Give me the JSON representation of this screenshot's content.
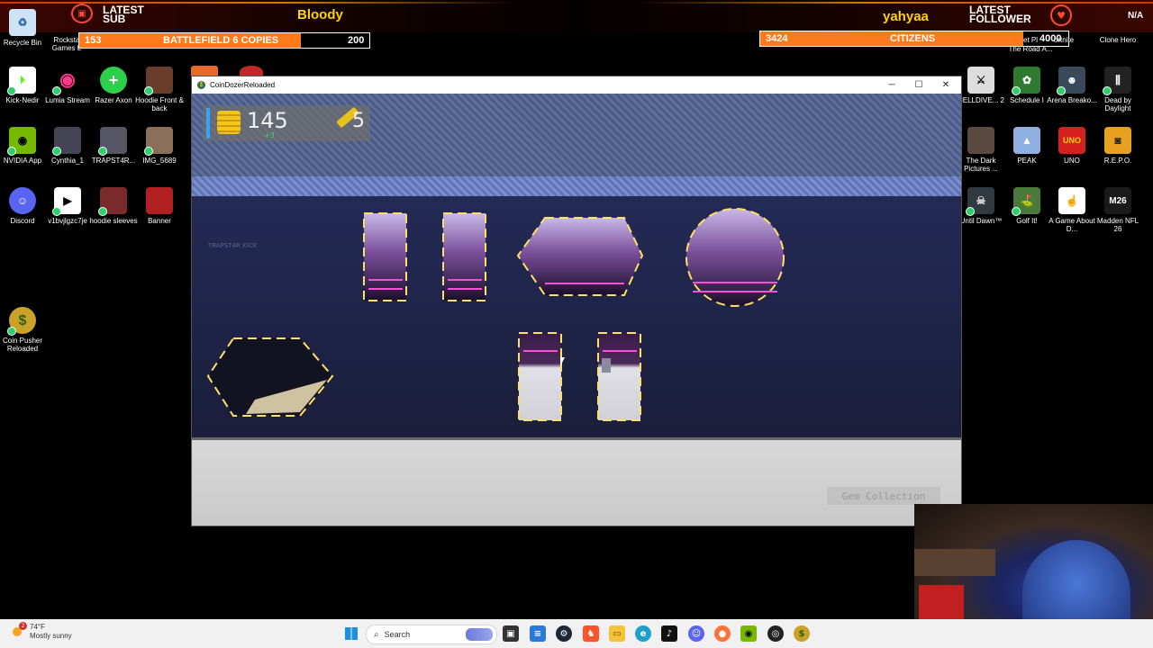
{
  "overlay": {
    "latest_sub_label": "LATEST\nSUB",
    "latest_sub_name": "Bloody",
    "latest_follower_label": "LATEST\nFOLLOWER",
    "latest_follower_name": "yahyaa",
    "corner_text": "N/A",
    "goal_left": {
      "current": "153",
      "title": "BATTLEFIELD 6 COPIES",
      "target": "200",
      "progress": 0.765
    },
    "goal_right": {
      "current": "3424",
      "title": "CITIZENS",
      "target": "4000",
      "progress": 0.856
    },
    "colors": {
      "accent": "#ff7a1a",
      "latest_name": "#ffd400",
      "heart": "#ff4a3a"
    }
  },
  "desktop_left": [
    {
      "label": "Recycle Bin",
      "icon": "recycle-bin-icon"
    },
    {
      "label": "Rocksta Games L",
      "icon": "rockstar-icon"
    },
    {
      "label": "Kick-Nedir",
      "icon": "kick-icon"
    },
    {
      "label": "Lumia Stream",
      "icon": "lumia-icon"
    },
    {
      "label": "Razer Axon",
      "icon": "razer-icon"
    },
    {
      "label": "Hoodie Front & back",
      "icon": "image-icon"
    },
    {
      "label": "NVIDIA App",
      "icon": "nvidia-icon"
    },
    {
      "label": "Cynthia_1",
      "icon": "image-icon"
    },
    {
      "label": "TRAPST4R...",
      "icon": "image-icon"
    },
    {
      "label": "IMG_5689",
      "icon": "image-icon"
    },
    {
      "label": "Discord",
      "icon": "discord-icon"
    },
    {
      "label": "v1bvjlgzc7je",
      "icon": "video-icon"
    },
    {
      "label": "hoodie sleeves",
      "icon": "image-icon"
    },
    {
      "label": "Banner",
      "icon": "image-icon"
    },
    {
      "label": "Coin Pusher Reloaded",
      "icon": "coin-icon"
    }
  ],
  "desktop_right": [
    {
      "label": "et Pl",
      "icon": "app-icon"
    },
    {
      "label": "ortnite",
      "icon": "fortnite-icon"
    },
    {
      "label": "Clone Hero",
      "icon": "clone-hero-icon"
    },
    {
      "label": "The Road A...",
      "icon": "app-icon"
    },
    {
      "label": "HELLDIVE... 2",
      "icon": "helldivers-icon"
    },
    {
      "label": "Schedule I",
      "icon": "schedule-icon"
    },
    {
      "label": "Arena Breako...",
      "icon": "arena-icon"
    },
    {
      "label": "Dead by Daylight",
      "icon": "dbd-icon"
    },
    {
      "label": "The Dark Pictures ...",
      "icon": "dark-pictures-icon"
    },
    {
      "label": "PEAK",
      "icon": "peak-icon"
    },
    {
      "label": "UNO",
      "icon": "uno-icon"
    },
    {
      "label": "R.E.P.O.",
      "icon": "repo-icon"
    },
    {
      "label": "Until Dawn™",
      "icon": "until-dawn-icon"
    },
    {
      "label": "Golf It!",
      "icon": "golf-icon"
    },
    {
      "label": "A Game About D...",
      "icon": "game-icon"
    },
    {
      "label": "Madden NFL 26",
      "icon": "madden-icon"
    }
  ],
  "window": {
    "title": "CoinDozerReloaded",
    "coins": "145",
    "coin_delta": "+3",
    "gems": "5",
    "watermark": "TRAPST4R  KICK",
    "gem_collection_label": "Gem Collection"
  },
  "taskbar": {
    "weather_temp": "74°F",
    "weather_desc": "Mostly sunny",
    "notification_count": "2",
    "search_placeholder": "Search"
  }
}
